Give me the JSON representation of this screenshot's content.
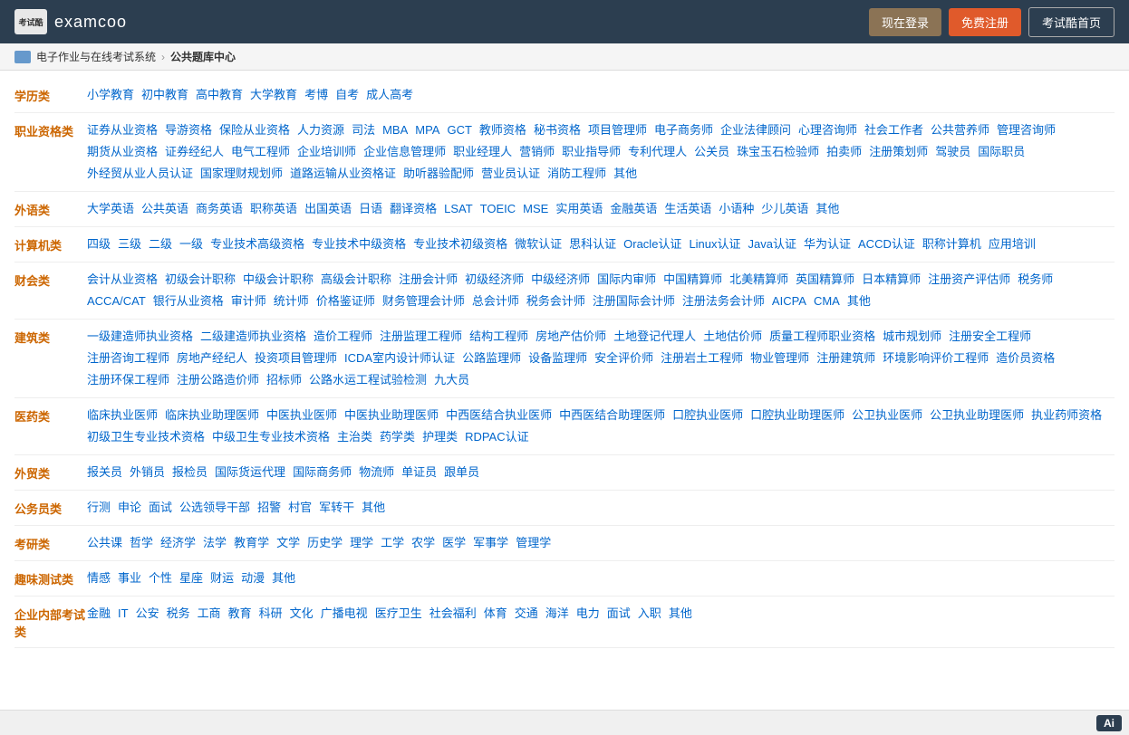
{
  "header": {
    "logo_icon_text": "考试酷",
    "logo_text": "examcoo",
    "btn_login": "现在登录",
    "btn_register": "免费注册",
    "btn_home": "考试酷首页"
  },
  "breadcrumb": {
    "link": "电子作业与在线考试系统",
    "current": "公共题库中心"
  },
  "categories": [
    {
      "label": "学历类",
      "items": [
        "小学教育",
        "初中教育",
        "高中教育",
        "大学教育",
        "考博",
        "自考",
        "成人高考"
      ]
    },
    {
      "label": "职业资格类",
      "items": [
        "证券从业资格",
        "导游资格",
        "保险从业资格",
        "人力资源",
        "司法",
        "MBA",
        "MPA",
        "GCT",
        "教师资格",
        "秘书资格",
        "项目管理师",
        "电子商务师",
        "企业法律顾问",
        "心理咨询师",
        "社会工作者",
        "公共营养师",
        "管理咨询师",
        "期货从业资格",
        "证券经纪人",
        "电气工程师",
        "企业培训师",
        "企业信息管理师",
        "职业经理人",
        "营销师",
        "职业指导师",
        "专利代理人",
        "公关员",
        "珠宝玉石检验师",
        "拍卖师",
        "注册策划师",
        "驾驶员",
        "国际职员",
        "外经贸从业人员认证",
        "国家理财规划师",
        "道路运输从业资格证",
        "助听器验配师",
        "营业员认证",
        "消防工程师",
        "其他"
      ]
    },
    {
      "label": "外语类",
      "items": [
        "大学英语",
        "公共英语",
        "商务英语",
        "职称英语",
        "出国英语",
        "日语",
        "翻译资格",
        "LSAT",
        "TOEIC",
        "MSE",
        "实用英语",
        "金融英语",
        "生活英语",
        "小语种",
        "少儿英语",
        "其他"
      ]
    },
    {
      "label": "计算机类",
      "items": [
        "四级",
        "三级",
        "二级",
        "一级",
        "专业技术高级资格",
        "专业技术中级资格",
        "专业技术初级资格",
        "微软认证",
        "思科认证",
        "Oracle认证",
        "Linux认证",
        "Java认证",
        "华为认证",
        "ACCD认证",
        "职称计算机",
        "应用培训"
      ]
    },
    {
      "label": "财会类",
      "items": [
        "会计从业资格",
        "初级会计职称",
        "中级会计职称",
        "高级会计职称",
        "注册会计师",
        "初级经济师",
        "中级经济师",
        "国际内审师",
        "中国精算师",
        "北美精算师",
        "英国精算师",
        "日本精算师",
        "注册资产评估师",
        "税务师",
        "ACCA/CAT",
        "银行从业资格",
        "审计师",
        "统计师",
        "价格鉴证师",
        "财务管理会计师",
        "总会计师",
        "税务会计师",
        "注册国际会计师",
        "注册法务会计师",
        "AICPA",
        "CMA",
        "其他"
      ]
    },
    {
      "label": "建筑类",
      "items": [
        "一级建造师执业资格",
        "二级建造师执业资格",
        "造价工程师",
        "注册监理工程师",
        "结构工程师",
        "房地产估价师",
        "土地登记代理人",
        "土地估价师",
        "质量工程师职业资格",
        "城市规划师",
        "注册安全工程师",
        "注册咨询工程师",
        "房地产经纪人",
        "投资项目管理师",
        "ICDA室内设计师认证",
        "公路监理师",
        "设备监理师",
        "安全评价师",
        "注册岩土工程师",
        "物业管理师",
        "注册建筑师",
        "环境影响评价工程师",
        "造价员资格",
        "注册环保工程师",
        "注册公路造价师",
        "招标师",
        "公路水运工程试验检测",
        "九大员"
      ]
    },
    {
      "label": "医药类",
      "items": [
        "临床执业医师",
        "临床执业助理医师",
        "中医执业医师",
        "中医执业助理医师",
        "中西医结合执业医师",
        "中西医结合助理医师",
        "口腔执业医师",
        "口腔执业助理医师",
        "公卫执业医师",
        "公卫执业助理医师",
        "执业药师资格",
        "初级卫生专业技术资格",
        "中级卫生专业技术资格",
        "主治类",
        "药学类",
        "护理类",
        "RDPAC认证"
      ]
    },
    {
      "label": "外贸类",
      "items": [
        "报关员",
        "外销员",
        "报检员",
        "国际货运代理",
        "国际商务师",
        "物流师",
        "单证员",
        "跟单员"
      ]
    },
    {
      "label": "公务员类",
      "items": [
        "行测",
        "申论",
        "面试",
        "公选领导干部",
        "招警",
        "村官",
        "军转干",
        "其他"
      ]
    },
    {
      "label": "考研类",
      "items": [
        "公共课",
        "哲学",
        "经济学",
        "法学",
        "教育学",
        "文学",
        "历史学",
        "理学",
        "工学",
        "农学",
        "医学",
        "军事学",
        "管理学"
      ]
    },
    {
      "label": "趣味测试类",
      "items": [
        "情感",
        "事业",
        "个性",
        "星座",
        "财运",
        "动漫",
        "其他"
      ]
    },
    {
      "label": "企业内部考试类",
      "items": [
        "金融",
        "IT",
        "公安",
        "税务",
        "工商",
        "教育",
        "科研",
        "文化",
        "广播电视",
        "医疗卫生",
        "社会福利",
        "体育",
        "交通",
        "海洋",
        "电力",
        "面试",
        "入职",
        "其他"
      ]
    }
  ],
  "footer": {
    "ai_label": "Ai"
  }
}
